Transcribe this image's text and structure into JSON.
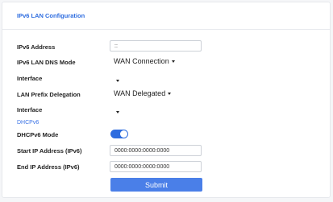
{
  "header": {
    "title": "IPv6 LAN Configuration"
  },
  "form": {
    "ipv6_address": {
      "label": "IPv6 Address",
      "value": "::"
    },
    "dns_mode": {
      "label": "IPv6 LAN DNS Mode",
      "value": "WAN Connection"
    },
    "interface1": {
      "label": "Interface",
      "value": ""
    },
    "prefix_delegation": {
      "label": "LAN Prefix Delegation",
      "value": "WAN Delegated"
    },
    "interface2": {
      "label": "Interface",
      "value": ""
    },
    "dhcpv6_section": "DHCPv6",
    "dhcpv6_mode": {
      "label": "DHCPv6 Mode",
      "enabled": true
    },
    "start_ip": {
      "label": "Start IP Address (IPv6)",
      "value": "0000:0000:0000:0000"
    },
    "end_ip": {
      "label": "End IP Address (IPv6)",
      "value": "0000:0000:0000:0000"
    },
    "submit_label": "Submit"
  },
  "colors": {
    "accent": "#2d6cdf",
    "button": "#4a7fe8"
  }
}
